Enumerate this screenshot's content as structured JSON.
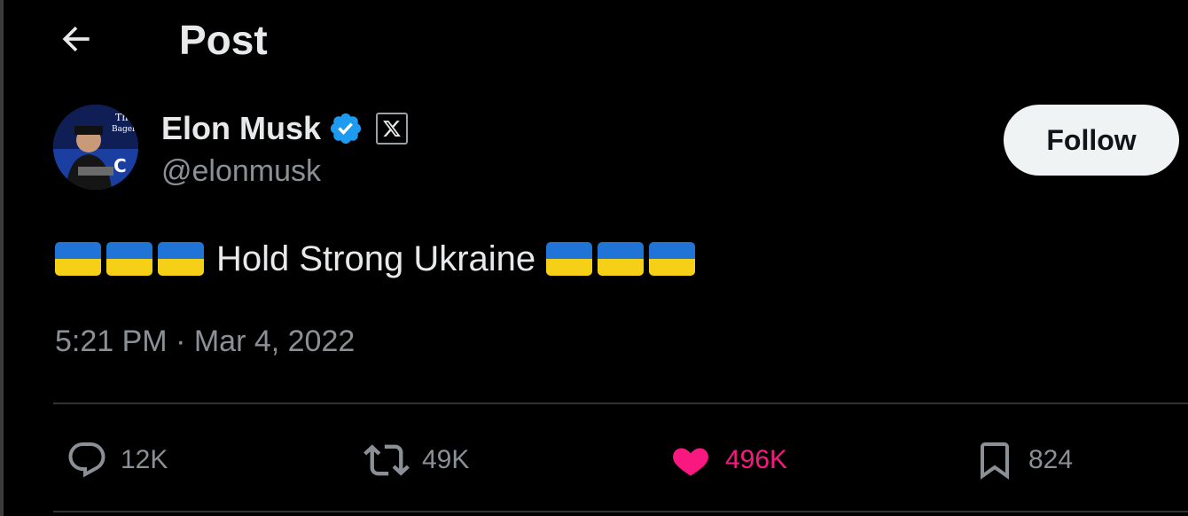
{
  "header": {
    "back_icon": "arrow-left-icon",
    "title": "Post"
  },
  "author": {
    "name": "Elon Musk",
    "handle": "@elonmusk",
    "verified_icon": "verified-badge-icon",
    "affiliation_icon": "x-logo-icon",
    "avatar_text_top": "The",
    "avatar_text_bottom": "Bagel's",
    "avatar_letter": "C"
  },
  "follow_button": {
    "label": "Follow"
  },
  "post": {
    "text": "Hold Strong Ukraine",
    "flag_emoji": "ukraine-flag",
    "timestamp": "5:21 PM · Mar 4, 2022"
  },
  "actions": {
    "reply": {
      "icon": "reply-icon",
      "count": "12K"
    },
    "repost": {
      "icon": "repost-icon",
      "count": "49K"
    },
    "like": {
      "icon": "heart-icon",
      "count": "496K",
      "liked": true
    },
    "bookmark": {
      "icon": "bookmark-icon",
      "count": "824"
    }
  },
  "colors": {
    "background": "#000000",
    "text_primary": "#e7e9ea",
    "text_secondary": "#8b9096",
    "verified_blue": "#1d9bf0",
    "like_pink": "#f91880",
    "flag_blue": "#1f74d6",
    "flag_yellow": "#f6cf17"
  }
}
